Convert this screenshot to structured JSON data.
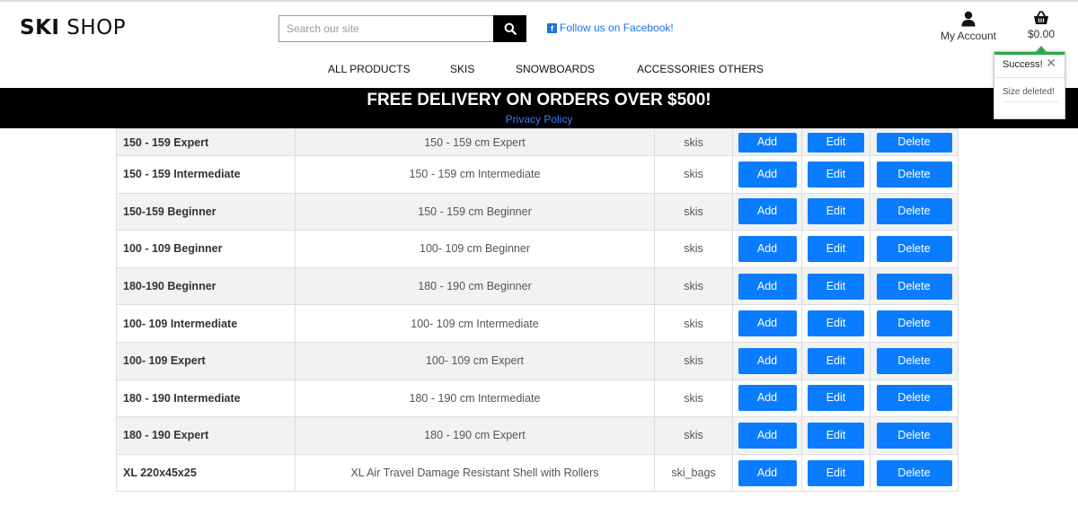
{
  "logo": {
    "bold": "SKI",
    "light": "SHOP"
  },
  "search": {
    "placeholder": "Search our site"
  },
  "facebook": {
    "label": "Follow us on Facebook!"
  },
  "account": {
    "label": "My Account"
  },
  "basket": {
    "total": "$0.00"
  },
  "nav": {
    "all_products": "ALL PRODUCTS",
    "skis": "SKIS",
    "snowboards": "SNOWBOARDS",
    "accessories": "ACCESSORIES",
    "others": "OTHERS"
  },
  "banner": {
    "promo": "FREE DELIVERY ON ORDERS OVER $500!",
    "privacy": "Privacy Policy"
  },
  "toast": {
    "title": "Success!",
    "message": "Size deleted!"
  },
  "buttons": {
    "add": "Add",
    "edit": "Edit",
    "delete": "Delete"
  },
  "rows": [
    {
      "code": "150 - 159 Expert",
      "name": "150 - 159 cm Expert",
      "category": "skis"
    },
    {
      "code": "150 - 159 Intermediate",
      "name": "150 - 159 cm Intermediate",
      "category": "skis"
    },
    {
      "code": "150-159 Beginner",
      "name": "150 - 159 cm Beginner",
      "category": "skis"
    },
    {
      "code": "100 - 109 Beginner",
      "name": "100- 109 cm Beginner",
      "category": "skis"
    },
    {
      "code": "180-190 Beginner",
      "name": "180 - 190 cm Beginner",
      "category": "skis"
    },
    {
      "code": "100- 109 Intermediate",
      "name": "100- 109 cm Intermediate",
      "category": "skis"
    },
    {
      "code": "100- 109 Expert",
      "name": "100- 109 cm Expert",
      "category": "skis"
    },
    {
      "code": "180 - 190 Intermediate",
      "name": "180 - 190 cm Intermediate",
      "category": "skis"
    },
    {
      "code": "180 - 190 Expert",
      "name": "180 - 190 cm Expert",
      "category": "skis"
    },
    {
      "code": "XL 220x45x25",
      "name": "XL Air Travel Damage Resistant Shell with Rollers",
      "category": "ski_bags"
    }
  ],
  "colors": {
    "accent": "#0a7cff",
    "banner_bg": "#000000",
    "link": "#1a73e8",
    "success": "#2ea84a"
  }
}
